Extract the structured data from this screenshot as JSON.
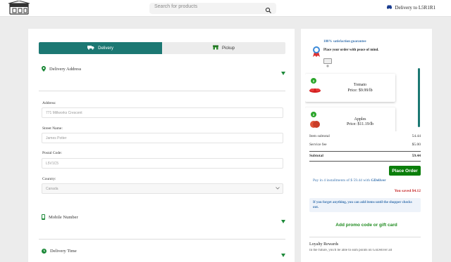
{
  "header": {
    "search_placeholder": "Search for products",
    "delivery_to": "Delivery to L5R1R1"
  },
  "mode_toggle": {
    "delivery_label": "Delivery",
    "pickup_label": "Pickup",
    "active": "Delivery"
  },
  "sections": {
    "delivery_address": "Delivery Address",
    "mobile_number": "Mobile Number",
    "delivery_time": "Delivery Time"
  },
  "form": {
    "address_label": "Address:",
    "address_value": "771 Millworks Crescent",
    "street_label": "Street Name:",
    "street_value": "James Potter",
    "postal_label": "Postal Code:",
    "postal_value": "L5V1C5",
    "country_label": "Country:",
    "country_value": "Canada"
  },
  "guarantee": {
    "title": "100% satisfaction guarantee",
    "subtitle": "Place your order with peace of mind."
  },
  "cart": {
    "items": [
      {
        "qty": "2",
        "name": "Tomato",
        "price": "Price: $9.99/lb"
      },
      {
        "qty": "2",
        "name": "Apples",
        "price": "Price: $11.19/lb"
      }
    ]
  },
  "summary": {
    "subtotal_label": "Item subtotal",
    "subtotal_value": "54.44",
    "fee_label": "Service fee",
    "fee_value": "$5.00",
    "total_label": "Subtotal",
    "total_value": "59.44"
  },
  "actions": {
    "place_order": "Place Order",
    "installments_prefix": "Pay in 4 installments of $ 59.44 with ",
    "installments_brand": "GDeliver",
    "saved": "You saved $4.12",
    "forget_note": "If you forget anything, you can add items until the shopper checks out.",
    "promo": "Add promo code or gift card"
  },
  "loyalty": {
    "title": "Loyalty Rewards",
    "subtitle": "In the future, you'll be able to earn points on GoDeliver all"
  },
  "colors": {
    "primary_teal": "#1c7873",
    "place_order_green": "#0a7e0a",
    "link_blue": "#3c75b0",
    "saved_red": "#c62828"
  }
}
